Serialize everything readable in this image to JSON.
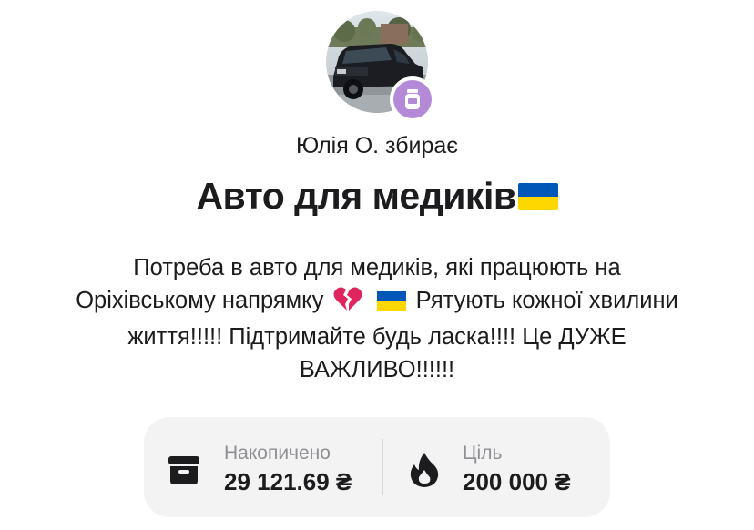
{
  "organizer": {
    "text": "Юлія О. збирає"
  },
  "jar": {
    "title": "Авто для медиків",
    "title_emoji": "ukraine-flag",
    "description_part1": "Потреба в авто для медиків, які працюють на Оріхівському напрямку",
    "description_part2": "Рятують кожної хвилини життя!!!!! Підтримайте будь ласка!!!! Це ДУЖЕ ВАЖЛИВО!!!!!!"
  },
  "stats": {
    "accumulated": {
      "label": "Накопичено",
      "value": "29 121.69 ₴",
      "icon": "archive-box-icon"
    },
    "goal": {
      "label": "Ціль",
      "value": "200 000 ₴",
      "icon": "flame-icon"
    }
  },
  "colors": {
    "badge": "#b389d8",
    "card_bg": "#f3f3f3",
    "label_gray": "#8e8e93",
    "flag_blue": "#0057b7",
    "flag_yellow": "#ffd700",
    "broken_heart": "#e0245e"
  }
}
